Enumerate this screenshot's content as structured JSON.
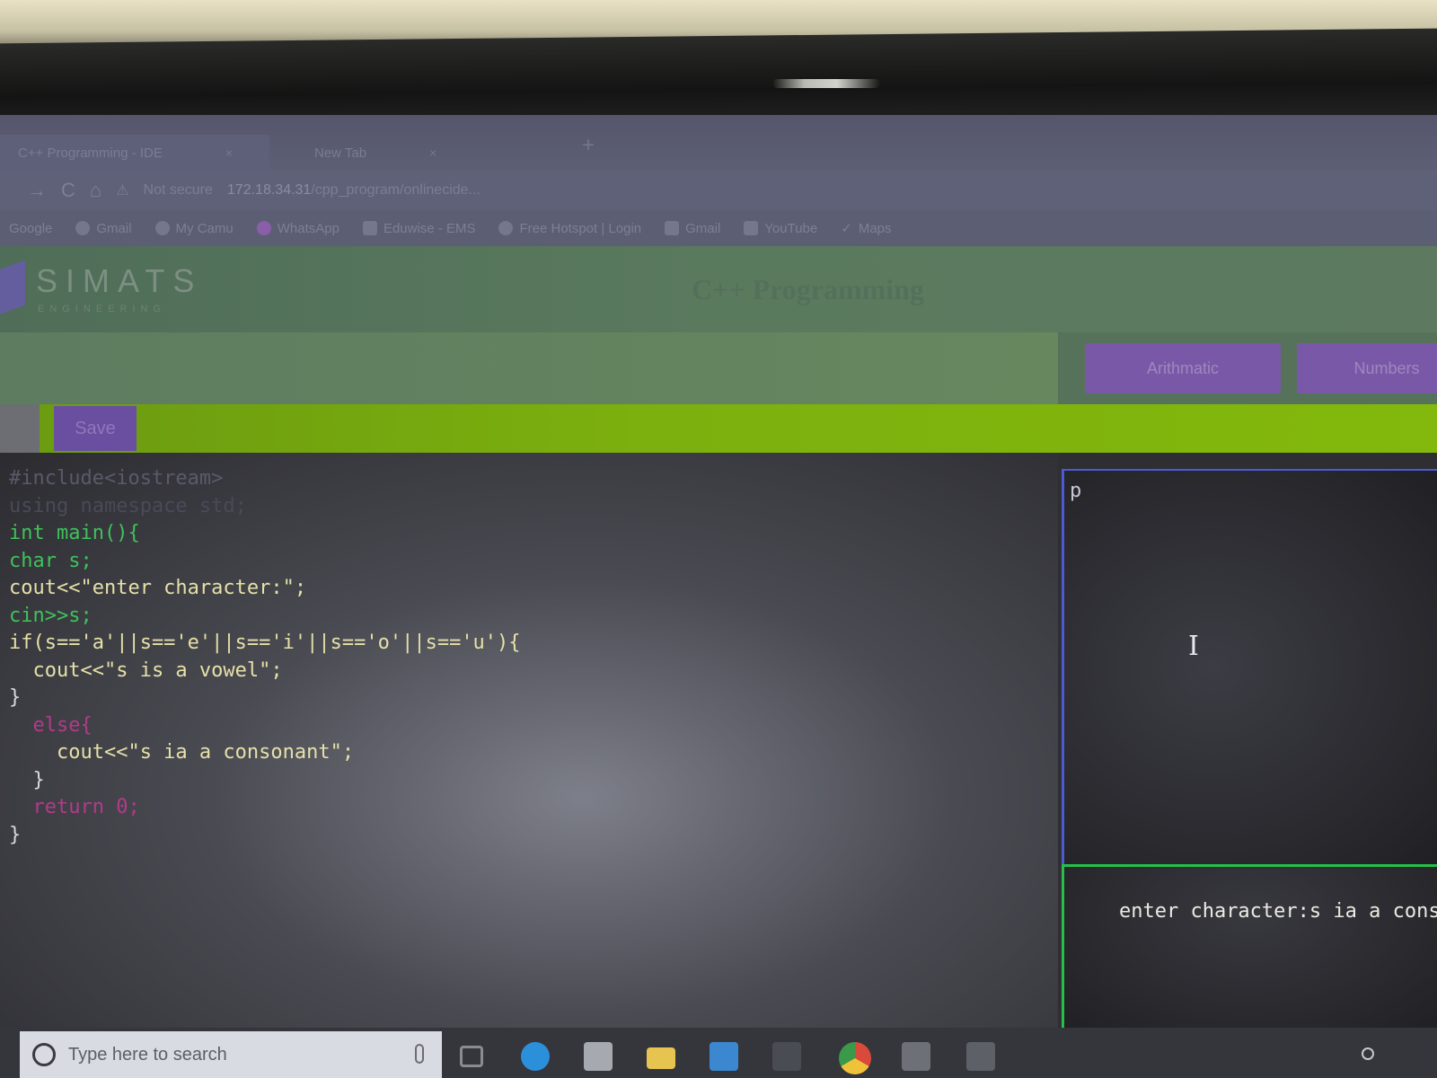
{
  "browser": {
    "tabs": [
      {
        "title": "C++ Programming - IDE",
        "close": "×"
      },
      {
        "title": "New Tab",
        "close": "×"
      }
    ],
    "new_tab": "+",
    "address": {
      "back": "→",
      "reload": "C",
      "home": "⌂",
      "security": "Not secure",
      "url_host": "172.18.34.31",
      "url_path": "/cpp_program/onlinecide..."
    },
    "bookmarks": [
      "Google",
      "Gmail",
      "My Camu",
      "WhatsApp",
      "Eduwise - EMS",
      "Free Hotspot | Login",
      "Gmail",
      "YouTube",
      "Maps"
    ]
  },
  "app": {
    "logo": "SIMATS",
    "logo_sub": "ENGINEERING",
    "title": "C++ Programming",
    "buttons": {
      "arithmetic": "Arithmatic",
      "next": "Numbers"
    },
    "save_label": "Save"
  },
  "code": [
    "#include<iostream>",
    "using namespace std;",
    "int main(){",
    "char s;",
    "cout<<\"enter character:\";",
    "cin>>s;",
    "if(s=='a'||s=='e'||s=='i'||s=='o'||s=='u'){",
    "  cout<<\"s is a vowel\";",
    "}",
    "  else{",
    "    cout<<\"s ia a consonant\";",
    "  }",
    "  return 0;",
    "}"
  ],
  "input_text": "p",
  "output_text": "enter character:s ia a consonant",
  "taskbar": {
    "search_placeholder": "Type here to search"
  },
  "colors": {
    "greenbar": "#7cb00e",
    "purple_button": "#7a58a8",
    "output_border": "#25c04a",
    "input_border": "#4b5bd6"
  }
}
